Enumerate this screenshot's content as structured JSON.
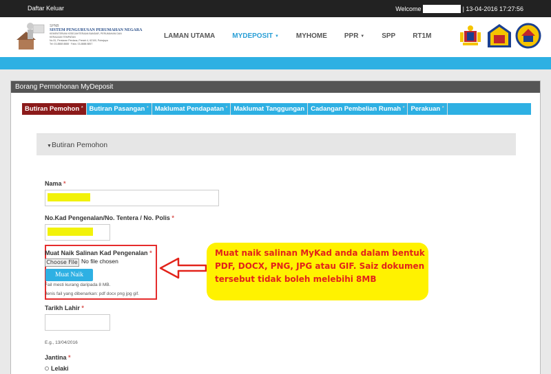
{
  "topbar": {
    "logout": "Daftar Keluar",
    "welcome": "Welcome",
    "datetime": "| 13-04-2016 17:27:56"
  },
  "logo": {
    "line1": "SPNB",
    "line2": "SISTEM PENGURUSAN PERUMAHAN NEGARA",
    "line3": "KEMENTERIAN KESEJAHTERAAN BANDAR, PERUMAHAN DAN KERAJAAN TEMPATAN",
    "line4": "No.51, Persiaran Perdana, Presint 4, 62100, Putrajaya",
    "line5": "Tel: 03-8888 8888 · Faks: 03-8888 8857"
  },
  "nav": {
    "items": [
      {
        "label": "LAMAN UTAMA"
      },
      {
        "label": "MYDEPOSIT"
      },
      {
        "label": "MYHOME"
      },
      {
        "label": "PPR"
      },
      {
        "label": "SPP"
      },
      {
        "label": "RT1M"
      }
    ]
  },
  "panel": {
    "title": "Borang Permohonan MyDeposit"
  },
  "tabs": [
    {
      "label": "Butiran Pemohon"
    },
    {
      "label": "Butiran Pasangan"
    },
    {
      "label": "Maklumat Pendapatan"
    },
    {
      "label": "Maklumat Tanggungan"
    },
    {
      "label": "Cadangan Pembelian Rumah"
    },
    {
      "label": "Perakuan"
    }
  ],
  "section": {
    "title": "Butiran Pemohon"
  },
  "form": {
    "nama_label": "Nama",
    "ic_label": "No.Kad Pengenalan/No. Tentera / No. Polis",
    "upload_label": "Muat Naik Salinan Kad Pengenalan",
    "choose_file": "Choose File",
    "no_file": "No file chosen",
    "upload_button": "Muat Naik",
    "size_note": "Fail mesti kurang daripada 8 MB.",
    "type_note": "Jenis fail yang dibenarkan: pdf docx png jpg gif.",
    "dob_label": "Tarikh Lahir",
    "dob_hint": "E.g., 13/04/2016",
    "gender_label": "Jantina",
    "gender_option": "Lelaki",
    "required_mark": "*"
  },
  "callout": {
    "line1": "Muat naik salinan MyKad anda dalam bentuk",
    "line2": "PDF, DOCX, PNG, JPG atau GIF. Saiz dokumen",
    "line3": "tersebut tidak boleh melebihi 8MB"
  },
  "colors": {
    "accent": "#2eb0e3",
    "active_tab": "#8b1a1a",
    "highlight": "#f2f20a",
    "callout_bg": "#fff200",
    "callout_text": "#e2231a"
  }
}
